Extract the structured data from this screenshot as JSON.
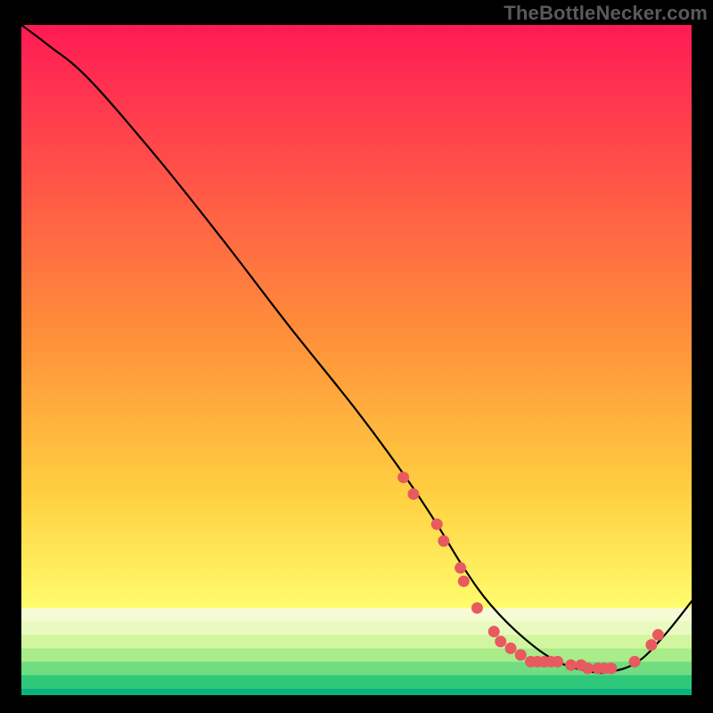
{
  "attribution": "TheBottleNecker.com",
  "chart_data": {
    "type": "line",
    "title": "",
    "xlabel": "",
    "ylabel": "",
    "xlim": [
      0,
      100
    ],
    "ylim": [
      0,
      100
    ],
    "series": [
      {
        "name": "curve",
        "x": [
          0,
          4,
          10,
          20,
          30,
          40,
          50,
          57,
          62,
          66,
          70,
          75,
          80,
          85,
          88,
          92,
          96,
          100
        ],
        "values": [
          100,
          97,
          92,
          80.5,
          68,
          55,
          42.5,
          33,
          25.5,
          19,
          13.5,
          8.5,
          5,
          3.5,
          3.5,
          5,
          9,
          14
        ]
      }
    ],
    "markers": [
      {
        "x": 57.0,
        "y": 32.5
      },
      {
        "x": 58.5,
        "y": 30.0
      },
      {
        "x": 62.0,
        "y": 25.5
      },
      {
        "x": 63.0,
        "y": 23.0
      },
      {
        "x": 65.5,
        "y": 19.0
      },
      {
        "x": 66.0,
        "y": 17.0
      },
      {
        "x": 68.0,
        "y": 13.0
      },
      {
        "x": 70.5,
        "y": 9.5
      },
      {
        "x": 71.5,
        "y": 8.0
      },
      {
        "x": 73.0,
        "y": 7.0
      },
      {
        "x": 74.5,
        "y": 6.0
      },
      {
        "x": 76.0,
        "y": 5.0
      },
      {
        "x": 77.0,
        "y": 5.0
      },
      {
        "x": 78.0,
        "y": 5.0
      },
      {
        "x": 79.0,
        "y": 5.0
      },
      {
        "x": 80.0,
        "y": 5.0
      },
      {
        "x": 82.0,
        "y": 4.5
      },
      {
        "x": 83.5,
        "y": 4.5
      },
      {
        "x": 84.5,
        "y": 4.0
      },
      {
        "x": 86.0,
        "y": 4.0
      },
      {
        "x": 87.0,
        "y": 4.0
      },
      {
        "x": 88.0,
        "y": 4.0
      },
      {
        "x": 91.5,
        "y": 5.0
      },
      {
        "x": 94.0,
        "y": 7.5
      },
      {
        "x": 95.0,
        "y": 9.0
      }
    ],
    "bottom_band": {
      "y_top": 13,
      "colors": [
        {
          "y": 13,
          "c": "#f6fbd5"
        },
        {
          "y": 11,
          "c": "#e9fac0"
        },
        {
          "y": 9,
          "c": "#d2f5a0"
        },
        {
          "y": 7,
          "c": "#a9ec8a"
        },
        {
          "y": 5,
          "c": "#70dd81"
        },
        {
          "y": 3,
          "c": "#2fc87a"
        },
        {
          "y": 1,
          "c": "#08b47b"
        }
      ]
    },
    "gradient_top": "#ff1a55",
    "gradient_mid": "#ffd040",
    "gradient_low": "#ffff70"
  }
}
